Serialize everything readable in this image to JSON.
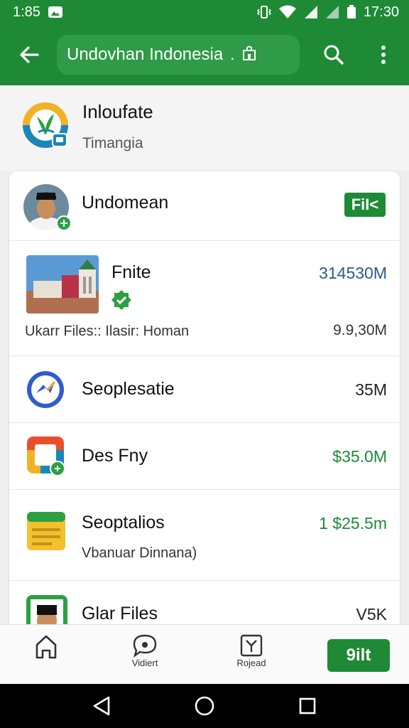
{
  "status_bar": {
    "left_time": "1:85",
    "right_time": "17:30",
    "icons": [
      "photo-icon",
      "vibrate-icon",
      "wifi-icon",
      "signal-icon",
      "signal-icon",
      "battery-icon"
    ]
  },
  "app_bar": {
    "search_text": "Undovhan Indonesia",
    "search_suffix": ".",
    "icons": [
      "back-arrow-icon",
      "store-icon",
      "search-icon",
      "more-vert-icon"
    ]
  },
  "header": {
    "title": "Inloufate",
    "subtitle": "Timangia"
  },
  "card": {
    "user_row": {
      "name": "Undomean",
      "badge": "FiI<"
    },
    "rows": [
      {
        "title": "Fnite",
        "value": "314530M",
        "sub_label": "Ukarr Files:: Ilasir: Homan",
        "sub_value": "9.9,30M"
      },
      {
        "title": "Seoplesatie",
        "value": "35M"
      },
      {
        "title": "Des Fny",
        "value": "$35.0M"
      },
      {
        "title": "Seoptalios",
        "value": "1 $25.5m",
        "sub_label": "Vbanuar Dinnana)"
      },
      {
        "title": "Glar Files",
        "value": "V5K"
      }
    ]
  },
  "bottom_nav": {
    "items": [
      {
        "label": "",
        "icon": "home-icon"
      },
      {
        "label": "Vidiert",
        "icon": "chat-bubble-icon"
      },
      {
        "label": "Rojead",
        "icon": "image-icon"
      }
    ],
    "action_label": "9ilt"
  },
  "colors": {
    "primary_green": "#1e8a36",
    "value_blue": "#2a5a8c"
  }
}
